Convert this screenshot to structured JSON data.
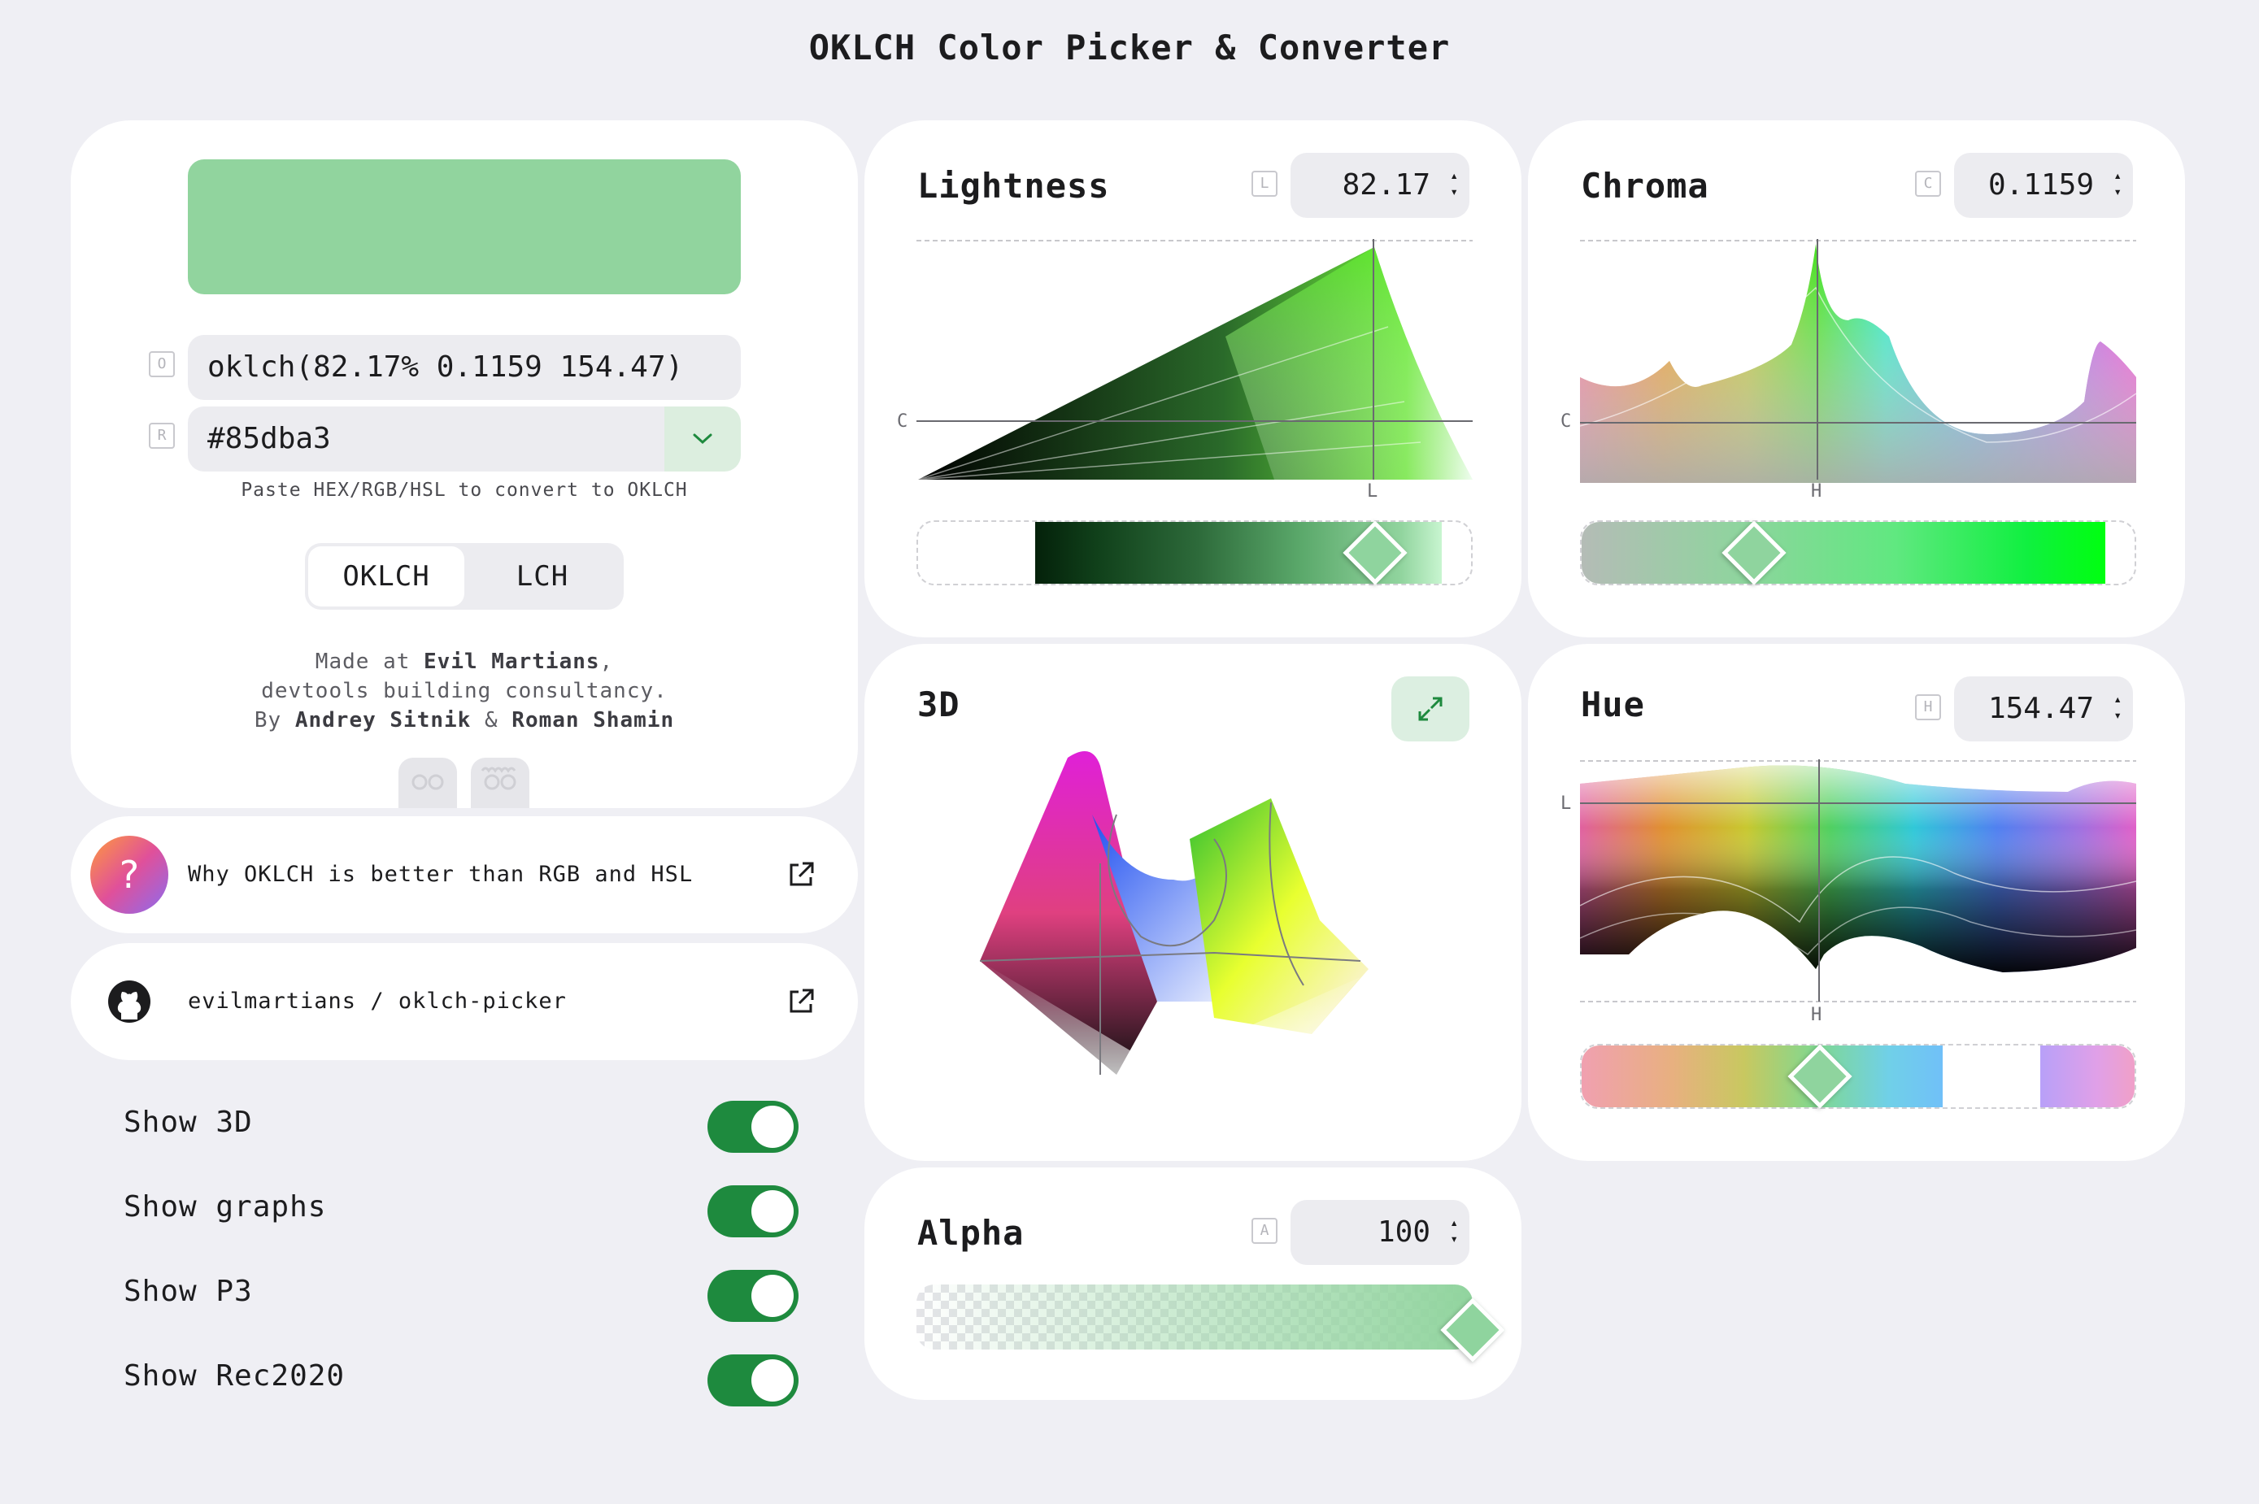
{
  "title": "OKLCH Color Picker & Converter",
  "color": {
    "swatch_hex": "#91d49e",
    "oklch_text": "oklch(82.17% 0.1159 154.47)",
    "hex_text": "#85dba3",
    "oklch_icon_letter": "O",
    "rgb_icon_letter": "R",
    "hint": "Paste HEX/RGB/HSL to convert to OKLCH"
  },
  "mode_switch": {
    "options": [
      "OKLCH",
      "LCH"
    ],
    "selected": "OKLCH"
  },
  "credits": {
    "line1_prefix": "Made at ",
    "line1_strong": "Evil Martians",
    "line1_suffix": ",",
    "line2": "devtools building consultancy.",
    "line3_prefix": "By ",
    "author1": "Andrey Sitnik",
    "amp": " & ",
    "author2": "Roman Shamin"
  },
  "links": [
    {
      "text": "Why OKLCH is better than RGB and HSL",
      "icon": "question-icon"
    },
    {
      "text": "evilmartians / oklch-picker",
      "icon": "github-icon"
    }
  ],
  "settings": [
    {
      "label": "Show 3D",
      "on": true
    },
    {
      "label": "Show graphs",
      "on": true
    },
    {
      "label": "Show P3",
      "on": true
    },
    {
      "label": "Show Rec2020",
      "on": true
    }
  ],
  "channels": {
    "lightness": {
      "title": "Lightness",
      "badge": "L",
      "value": "82.17",
      "x_axis": "L",
      "y_axis": "C",
      "fraction": 0.8217
    },
    "chroma": {
      "title": "Chroma",
      "badge": "C",
      "value": "0.1159",
      "x_axis": "H",
      "y_axis": "C",
      "fraction": 0.31
    },
    "hue": {
      "title": "Hue",
      "badge": "H",
      "value": "154.47",
      "x_axis": "H",
      "y_axis": "L",
      "fraction": 0.429
    },
    "alpha": {
      "title": "Alpha",
      "badge": "A",
      "value": "100",
      "fraction": 1.0
    }
  },
  "view3d": {
    "title": "3D"
  },
  "accent": "#1e8a3e"
}
